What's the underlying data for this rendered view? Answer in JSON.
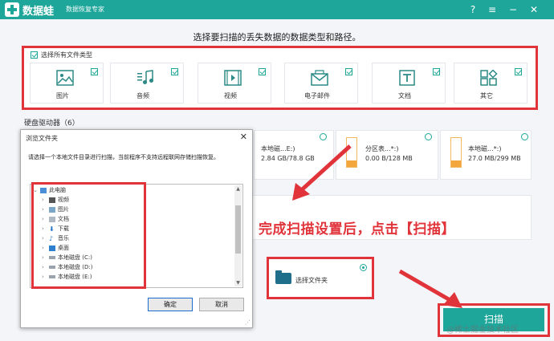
{
  "titlebar": {
    "app_name": "数据蛙",
    "subtitle": "数据恢复专家",
    "help_icon": "?",
    "settings_icon": "≡",
    "minimize_icon": "−",
    "close_icon": "✕"
  },
  "headline": "选择要扫描的丢失数据的数据类型和路径。",
  "file_types": {
    "select_all_label": "选择所有文件类型",
    "items": [
      {
        "label": "图片",
        "icon": "image-icon",
        "checked": true
      },
      {
        "label": "音频",
        "icon": "music-icon",
        "checked": true
      },
      {
        "label": "视频",
        "icon": "video-icon",
        "checked": true
      },
      {
        "label": "电子邮件",
        "icon": "mail-icon",
        "checked": true
      },
      {
        "label": "文档",
        "icon": "document-icon",
        "checked": true
      },
      {
        "label": "其它",
        "icon": "others-icon",
        "checked": true
      }
    ]
  },
  "drives": {
    "title": "硬盘驱动器（6）",
    "items": [
      {
        "name": "本地磁...E:)",
        "size": "2.84 GB/78.8 GB"
      },
      {
        "name": "分区表...*:)",
        "size": "0.00 B/128 MB"
      },
      {
        "name": "本地磁...*:)",
        "size": "27.0 MB/299 MB"
      }
    ]
  },
  "overlay_text": "完成扫描设置后，点击【扫描】",
  "folder_option": {
    "label": "选择文件夹",
    "selected": true
  },
  "scan_button": "扫描",
  "watermark": "@稀土掘金技术社区",
  "dialog": {
    "title": "浏览文件夹",
    "close_icon": "✕",
    "description": "请选择一个本地文件目录进行扫描，当前程序不支持远程联网存储扫描恢复。",
    "tree": [
      {
        "label": "此电脑",
        "icon": "computer-icon",
        "expanded": true
      },
      {
        "label": "视频",
        "icon": "video-folder-icon"
      },
      {
        "label": "图片",
        "icon": "picture-folder-icon"
      },
      {
        "label": "文档",
        "icon": "document-folder-icon"
      },
      {
        "label": "下载",
        "icon": "download-icon"
      },
      {
        "label": "音乐",
        "icon": "music-folder-icon"
      },
      {
        "label": "桌面",
        "icon": "desktop-icon"
      },
      {
        "label": "本地磁盘 (C:)",
        "icon": "disk-icon"
      },
      {
        "label": "本地磁盘 (D:)",
        "icon": "disk-icon"
      },
      {
        "label": "本地磁盘 (E:)",
        "icon": "disk-icon"
      }
    ],
    "ok_label": "确定",
    "cancel_label": "取消"
  },
  "colors": {
    "brand": "#1fa69b",
    "highlight": "#e0333a"
  }
}
